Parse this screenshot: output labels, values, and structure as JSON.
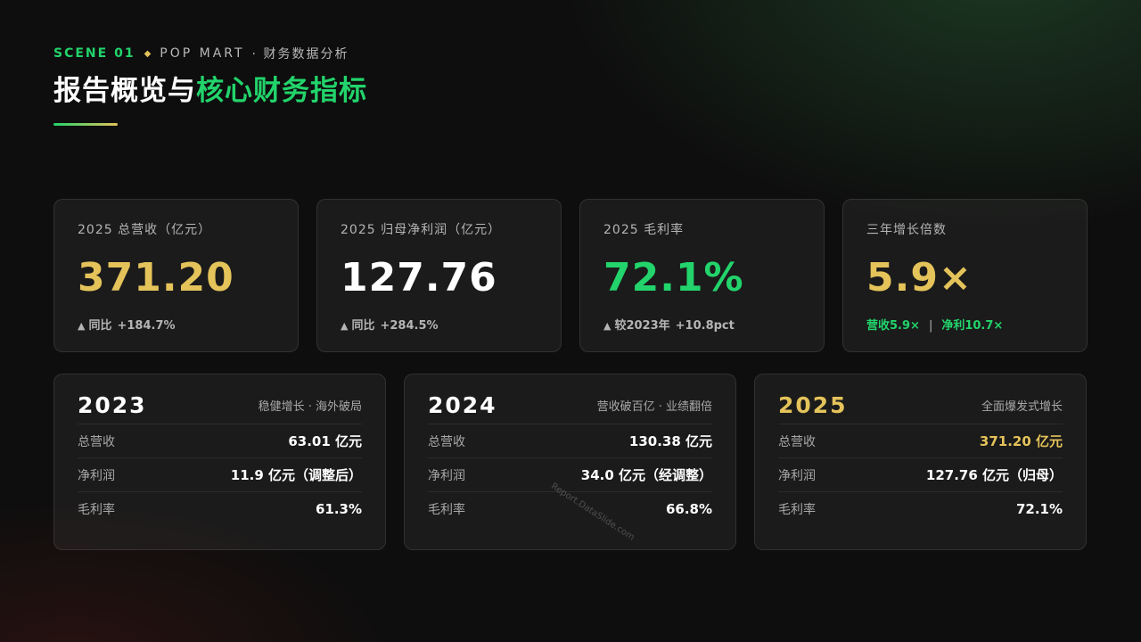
{
  "header": {
    "scene": "SCENE 01",
    "diamond": "◆",
    "brand": "POP MART",
    "subtitle": "· 财务数据分析",
    "title_main": "报告概览与",
    "title_highlight": "核心财务指标"
  },
  "kpis": [
    {
      "label": "2025 总营收（亿元）",
      "value": "371.20",
      "value_color": "#e4c35a",
      "change_prefix": "▲",
      "change_label": "同比",
      "change_value": "+184.7%"
    },
    {
      "label": "2025 归母净利润（亿元）",
      "value": "127.76",
      "value_color": "#ffffff",
      "change_prefix": "▲",
      "change_label": "同比",
      "change_value": "+284.5%"
    },
    {
      "label": "2025 毛利率",
      "value": "72.1%",
      "value_color": "#22d46b",
      "change_prefix": "▲",
      "change_label": "较2023年",
      "change_value": "+10.8pct"
    },
    {
      "label": "三年增长倍数",
      "value": "5.9×",
      "value_color": "#e4c35a",
      "revenue_multiple": "营收5.9×",
      "separator": "|",
      "profit_multiple": "净利10.7×"
    }
  ],
  "years": [
    {
      "year": "2023",
      "year_color": "#ffffff",
      "tag": "稳健增长 · 海外破局",
      "rows": [
        {
          "label": "总营收",
          "value": "63.01 亿元",
          "color": "#ffffff"
        },
        {
          "label": "净利润",
          "value": "11.9 亿元（调整后）",
          "color": "#ffffff"
        },
        {
          "label": "毛利率",
          "value": "61.3%",
          "color": "#ffffff"
        }
      ]
    },
    {
      "year": "2024",
      "year_color": "#ffffff",
      "tag": "营收破百亿 · 业绩翻倍",
      "rows": [
        {
          "label": "总营收",
          "value": "130.38 亿元",
          "color": "#ffffff"
        },
        {
          "label": "净利润",
          "value": "34.0 亿元（经调整）",
          "color": "#ffffff"
        },
        {
          "label": "毛利率",
          "value": "66.8%",
          "color": "#ffffff"
        }
      ]
    },
    {
      "year": "2025",
      "year_color": "#e4c35a",
      "tag": "全面爆发式增长",
      "rows": [
        {
          "label": "总营收",
          "value": "371.20 亿元",
          "color": "#e4c35a"
        },
        {
          "label": "净利润",
          "value": "127.76 亿元（归母）",
          "color": "#ffffff"
        },
        {
          "label": "毛利率",
          "value": "72.1%",
          "color": "#ffffff"
        }
      ]
    }
  ],
  "watermark": "Report.DataSlide.com"
}
